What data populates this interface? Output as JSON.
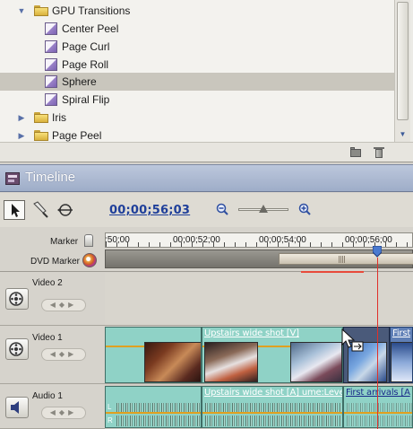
{
  "effects_tree": {
    "items": [
      {
        "label": "GPU Transitions",
        "kind": "folder",
        "expanded": true
      },
      {
        "label": "Center Peel",
        "kind": "transition"
      },
      {
        "label": "Page Curl",
        "kind": "transition"
      },
      {
        "label": "Page Roll",
        "kind": "transition"
      },
      {
        "label": "Sphere",
        "kind": "transition",
        "selected": true
      },
      {
        "label": "Spiral Flip",
        "kind": "transition"
      },
      {
        "label": "Iris",
        "kind": "folder",
        "expanded": false
      },
      {
        "label": "Page Peel",
        "kind": "folder",
        "expanded": false
      }
    ],
    "icons": {
      "new_bin": "new-bin-icon",
      "delete": "trash-icon"
    }
  },
  "timeline": {
    "title": "Timeline",
    "timecode": "00;00;56;03",
    "tools": [
      "selection-tool",
      "razor-tool",
      "track-select-tool"
    ],
    "zoom": {
      "out_icon": "zoom-out-icon",
      "in_icon": "zoom-in-icon",
      "level": 0.5
    },
    "ruler": {
      "marker_label": "Marker",
      "dvd_marker_label": "DVD Marker",
      "ticks": [
        ";50;00",
        "00;00;52;00",
        "00;00;54;00",
        "00;00;56;00"
      ]
    },
    "tracks": [
      {
        "name": "Video 2",
        "type": "video"
      },
      {
        "name": "Video 1",
        "type": "video"
      },
      {
        "name": "Audio 1",
        "type": "audio"
      }
    ],
    "clips": {
      "video1_a": {
        "label": ""
      },
      "video1_b": {
        "label": "Upstairs wide shot [V]"
      },
      "video1_c": {
        "label": "First"
      },
      "audio1_b": {
        "label": "Upstairs wide shot [A] ume:Level ▾"
      },
      "audio1_c": {
        "label": "First arrivals [A"
      }
    },
    "audio_channels": {
      "left": "L",
      "right": "R"
    },
    "colors": {
      "clip": "#8fd2c6",
      "timecode": "#1f3f9a",
      "playhead": "#e0302a",
      "opacity_line": "#e0a020",
      "title_bar": "#a9b6cf"
    }
  }
}
